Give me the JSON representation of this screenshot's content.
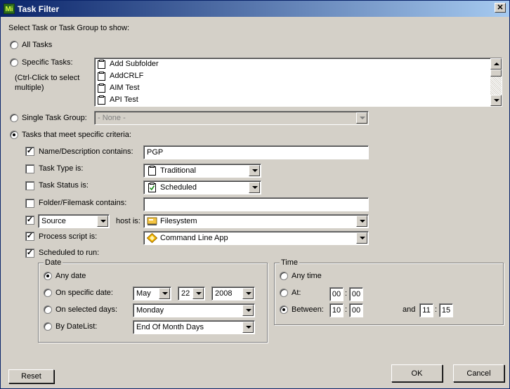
{
  "window": {
    "title": "Task Filter",
    "app_icon_text": "Mi",
    "close_label": "✕"
  },
  "prompt": "Select Task or Task Group to show:",
  "options": {
    "all_tasks": "All Tasks",
    "specific_tasks": "Specific Tasks:",
    "specific_hint_1": "(Ctrl-Click to select",
    "specific_hint_2": "multiple)",
    "single_group": "Single Task Group:",
    "criteria": "Tasks that meet specific criteria:"
  },
  "task_list": [
    "Add Subfolder",
    "AddCRLF",
    "AIM Test",
    "API Test"
  ],
  "single_group_value": "- None -",
  "criteria": {
    "name_desc": {
      "label": "Name/Description contains:",
      "checked": true,
      "value": "PGP"
    },
    "task_type": {
      "label": "Task Type is:",
      "checked": false,
      "value": "Traditional"
    },
    "task_status": {
      "label": "Task Status is:",
      "checked": false,
      "value": "Scheduled"
    },
    "folder_mask": {
      "label": "Folder/Filemask contains:",
      "checked": false,
      "value": ""
    },
    "host": {
      "checked": true,
      "side": "Source",
      "label": "host is:",
      "value": "Filesystem"
    },
    "process_script": {
      "label": "Process script is:",
      "checked": true,
      "value": "Command Line App"
    },
    "scheduled": {
      "label": "Scheduled to run:",
      "checked": true
    }
  },
  "date_group": {
    "legend": "Date",
    "any_date": "Any date",
    "specific_date": "On specific date:",
    "month": "May",
    "day": "22",
    "year": "2008",
    "selected_days": "On selected days:",
    "selected_days_value": "Monday",
    "datelist": "By DateList:",
    "datelist_value": "End Of Month Days"
  },
  "time_group": {
    "legend": "Time",
    "any_time": "Any time",
    "at": "At:",
    "at_hour": "00",
    "at_min": "00",
    "between": "Between:",
    "from_hour": "10",
    "from_min": "00",
    "and": "and",
    "to_hour": "11",
    "to_min": "15",
    "sep": ":"
  },
  "buttons": {
    "reset": "Reset",
    "ok": "OK",
    "cancel": "Cancel"
  },
  "check_mark": "✓"
}
